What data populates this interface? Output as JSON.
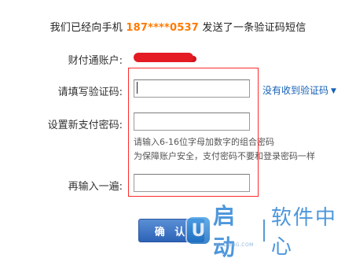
{
  "header": {
    "prefix": "我们已经向手机",
    "phone": "187****0537",
    "suffix": "发送了一条验证码短信"
  },
  "account": {
    "label": "财付通账户:"
  },
  "verification": {
    "label": "请填写验证码:",
    "value": "",
    "resend_link": "没有收到验证码"
  },
  "new_password": {
    "label": "设置新支付密码:",
    "value": "",
    "hint_line1": "请输入6-16位字母加数字的组合密码",
    "hint_line2": "为保障账户安全，支付密码不要和登录密码一样"
  },
  "confirm_password": {
    "label": "再输入一遍:",
    "value": ""
  },
  "confirm_button": "确 认",
  "watermark": {
    "logo_letter": "U",
    "brand": "启动",
    "name": "软件中心",
    "sub": "UQIDONG.COM"
  },
  "colors": {
    "phone_highlight": "#ff7a00",
    "link": "#1560b7",
    "highlight_box": "#ff2a2a",
    "redaction": "#e41b23",
    "button": "#2d63b7"
  }
}
